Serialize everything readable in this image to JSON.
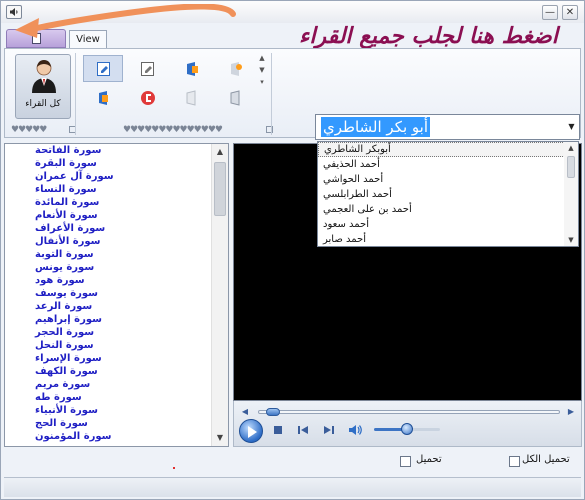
{
  "titlebar": {
    "minimize_symbol": "—",
    "close_symbol": "✕",
    "banner": "اضغط هنا لجلب جميع القراء"
  },
  "ribbon": {
    "tabs": [
      {
        "label": "",
        "icon": "document-icon"
      },
      {
        "label": "View"
      }
    ],
    "readers_button": {
      "label": "كل القراء",
      "icon": "person-icon"
    },
    "group_caption_dots": "♥♥♥♥♥",
    "gallery_caption_dots": "♥♥♥♥♥♥♥♥♥♥♥♥♥♥",
    "gallery_icons": [
      "view-icon",
      "edit-icon",
      "office-icon",
      "office-badge-icon",
      "office-icon",
      "office-logo-icon",
      "blank-page-icon",
      "page-icon"
    ]
  },
  "surahs": [
    "سورة الفاتحة",
    "سورة البقرة",
    "سورة آل عمران",
    "سورة النساء",
    "سورة المائدة",
    "سورة الأنعام",
    "سورة الأعراف",
    "سورة الأنفال",
    "سورة التوبة",
    "سورة يونس",
    "سورة هود",
    "سورة يوسف",
    "سورة الرعد",
    "سورة إبراهيم",
    "سورة الحجر",
    "سورة النحل",
    "سورة الإسراء",
    "سورة الكهف",
    "سورة مريم",
    "سورة طه",
    "سورة الأنبياء",
    "سورة الحج",
    "سورة المؤمنون"
  ],
  "reader_combo": {
    "selected": "أبو بكر الشاطري",
    "dropdown_arrow": "▼"
  },
  "reader_dropdown": {
    "items": [
      "أبوبكر الشاطري",
      "أحمد الحذيفي",
      "أحمد الحواشي",
      "أحمد الطرابلسي",
      "أحمد بن على العجمي",
      "أحمد سعود",
      "أحمد صابر"
    ],
    "selected_index": 0
  },
  "player": {
    "seek_position": 0.02,
    "volume": 0.5
  },
  "options": {
    "download_all_label": "تحميل الكل",
    "download_label": "تحميل",
    "download_all_checked": false,
    "download_checked": false
  },
  "colors": {
    "banner": "#8b0f52",
    "surah_text": "#1f1fc4",
    "combo_highlight": "#3399ff",
    "arrow": "#f0915a"
  }
}
